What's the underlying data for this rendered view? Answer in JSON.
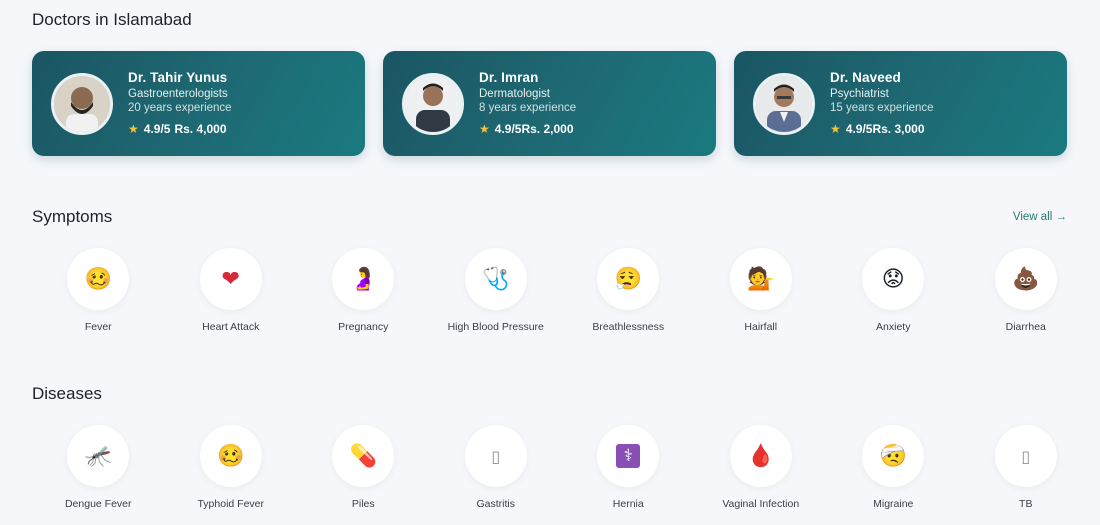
{
  "doctors_section": {
    "title": "Doctors in Islamabad",
    "doctors": [
      {
        "name": "Dr. Tahir Yunus",
        "specialty": "Gastroenterologists",
        "experience": "20 years experience",
        "rating": "4.9/5",
        "fee": "Rs. 4,000"
      },
      {
        "name": "Dr. Imran",
        "specialty": "Dermatologist",
        "experience": "8 years experience",
        "rating": "4.9/5",
        "fee": "Rs. 2,000"
      },
      {
        "name": "Dr. Naveed",
        "specialty": "Psychiatrist",
        "experience": "15 years experience",
        "rating": "4.9/5",
        "fee": "Rs. 3,000"
      }
    ],
    "rating_icon": "star-icon",
    "accent_color": "#1e6a74"
  },
  "symptoms_section": {
    "title": "Symptoms",
    "view_all": "View all →",
    "items": [
      {
        "label": "Fever",
        "icon": "fever-face-icon",
        "glyph": "🥴"
      },
      {
        "label": "Heart Attack",
        "icon": "heart-icon",
        "glyph": "❤"
      },
      {
        "label": "Pregnancy",
        "icon": "pregnant-woman-icon",
        "glyph": "🤰"
      },
      {
        "label": "High Blood Pressure",
        "icon": "stethoscope-icon",
        "glyph": "🩺"
      },
      {
        "label": "Breathlessness",
        "icon": "breath-face-icon",
        "glyph": "😮‍💨"
      },
      {
        "label": "Hairfall",
        "icon": "person-hair-icon",
        "glyph": "💁"
      },
      {
        "label": "Anxiety",
        "icon": "worried-face-icon",
        "glyph": "😟"
      },
      {
        "label": "Diarrhea",
        "icon": "poop-icon",
        "glyph": "💩"
      }
    ]
  },
  "diseases_section": {
    "title": "Diseases",
    "items": [
      {
        "label": "Dengue Fever",
        "icon": "mosquito-icon",
        "glyph": "🦟"
      },
      {
        "label": "Typhoid Fever",
        "icon": "fever-face-icon",
        "glyph": "🥴"
      },
      {
        "label": "Piles",
        "icon": "pill-icon",
        "glyph": "💊"
      },
      {
        "label": "Gastritis",
        "icon": "missing-glyph-icon",
        "glyph": "▯"
      },
      {
        "label": "Hernia",
        "icon": "medical-symbol-icon",
        "glyph": "⚕"
      },
      {
        "label": "Vaginal Infection",
        "icon": "blood-drop-icon",
        "glyph": "🩸"
      },
      {
        "label": "Migraine",
        "icon": "bandaged-face-icon",
        "glyph": "🤕"
      },
      {
        "label": "TB",
        "icon": "missing-glyph-icon",
        "glyph": "▯"
      }
    ]
  }
}
